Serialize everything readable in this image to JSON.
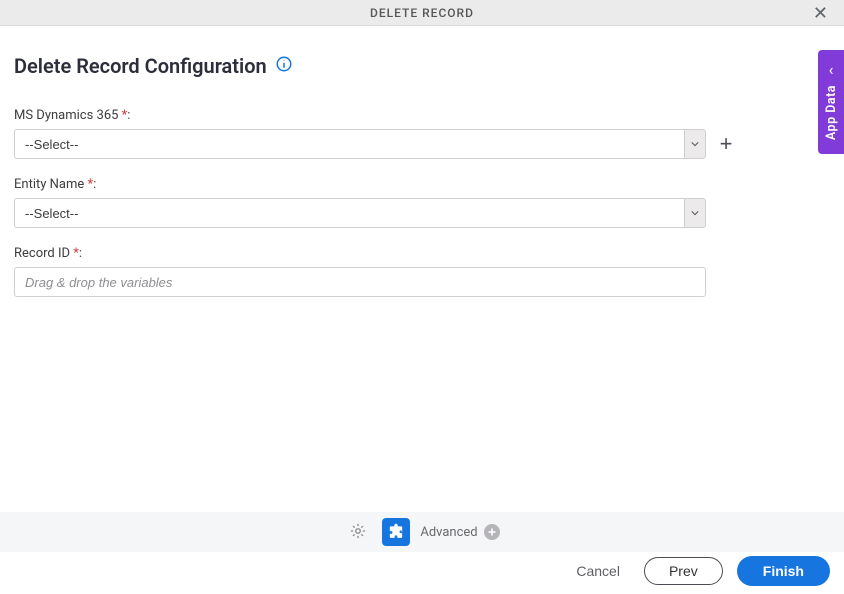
{
  "header": {
    "title": "DELETE RECORD"
  },
  "section": {
    "title": "Delete Record Configuration"
  },
  "fields": {
    "ms_dynamics": {
      "label": "MS Dynamics 365 ",
      "value": "--Select--"
    },
    "entity_name": {
      "label": "Entity Name ",
      "value": "--Select--"
    },
    "record_id": {
      "label": "Record ID ",
      "placeholder": "Drag & drop the variables"
    }
  },
  "footer": {
    "advanced": "Advanced"
  },
  "actions": {
    "cancel": "Cancel",
    "prev": "Prev",
    "finish": "Finish"
  },
  "side_panel": {
    "label": "App Data"
  }
}
